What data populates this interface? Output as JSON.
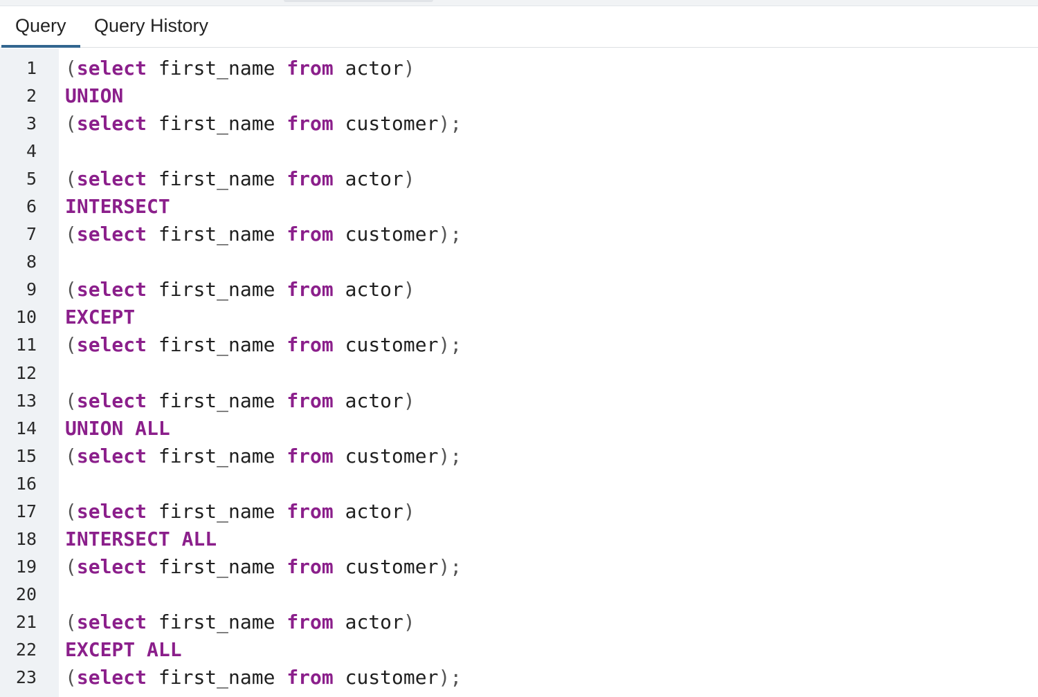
{
  "tabs": [
    {
      "label": "Query",
      "active": true
    },
    {
      "label": "Query History",
      "active": false
    }
  ],
  "colors": {
    "keyword": "#8b1f8b",
    "tab_indicator": "#326690",
    "gutter": "#eff2f5"
  },
  "editor": {
    "lines": [
      [
        {
          "t": "(",
          "c": "punc"
        },
        {
          "t": "select",
          "c": "kw"
        },
        {
          "t": " first_name ",
          "c": "id"
        },
        {
          "t": "from",
          "c": "kw"
        },
        {
          "t": " actor",
          "c": "id"
        },
        {
          "t": ")",
          "c": "punc"
        }
      ],
      [
        {
          "t": "UNION",
          "c": "kw"
        }
      ],
      [
        {
          "t": "(",
          "c": "punc"
        },
        {
          "t": "select",
          "c": "kw"
        },
        {
          "t": " first_name ",
          "c": "id"
        },
        {
          "t": "from",
          "c": "kw"
        },
        {
          "t": " customer",
          "c": "id"
        },
        {
          "t": ");",
          "c": "punc"
        }
      ],
      [],
      [
        {
          "t": "(",
          "c": "punc"
        },
        {
          "t": "select",
          "c": "kw"
        },
        {
          "t": " first_name ",
          "c": "id"
        },
        {
          "t": "from",
          "c": "kw"
        },
        {
          "t": " actor",
          "c": "id"
        },
        {
          "t": ")",
          "c": "punc"
        }
      ],
      [
        {
          "t": "INTERSECT",
          "c": "kw"
        }
      ],
      [
        {
          "t": "(",
          "c": "punc"
        },
        {
          "t": "select",
          "c": "kw"
        },
        {
          "t": " first_name ",
          "c": "id"
        },
        {
          "t": "from",
          "c": "kw"
        },
        {
          "t": " customer",
          "c": "id"
        },
        {
          "t": ");",
          "c": "punc"
        }
      ],
      [],
      [
        {
          "t": "(",
          "c": "punc"
        },
        {
          "t": "select",
          "c": "kw"
        },
        {
          "t": " first_name ",
          "c": "id"
        },
        {
          "t": "from",
          "c": "kw"
        },
        {
          "t": " actor",
          "c": "id"
        },
        {
          "t": ")",
          "c": "punc"
        }
      ],
      [
        {
          "t": "EXCEPT",
          "c": "kw"
        }
      ],
      [
        {
          "t": "(",
          "c": "punc"
        },
        {
          "t": "select",
          "c": "kw"
        },
        {
          "t": " first_name ",
          "c": "id"
        },
        {
          "t": "from",
          "c": "kw"
        },
        {
          "t": " customer",
          "c": "id"
        },
        {
          "t": ");",
          "c": "punc"
        }
      ],
      [],
      [
        {
          "t": "(",
          "c": "punc"
        },
        {
          "t": "select",
          "c": "kw"
        },
        {
          "t": " first_name ",
          "c": "id"
        },
        {
          "t": "from",
          "c": "kw"
        },
        {
          "t": " actor",
          "c": "id"
        },
        {
          "t": ")",
          "c": "punc"
        }
      ],
      [
        {
          "t": "UNION ALL",
          "c": "kw"
        }
      ],
      [
        {
          "t": "(",
          "c": "punc"
        },
        {
          "t": "select",
          "c": "kw"
        },
        {
          "t": " first_name ",
          "c": "id"
        },
        {
          "t": "from",
          "c": "kw"
        },
        {
          "t": " customer",
          "c": "id"
        },
        {
          "t": ");",
          "c": "punc"
        }
      ],
      [],
      [
        {
          "t": "(",
          "c": "punc"
        },
        {
          "t": "select",
          "c": "kw"
        },
        {
          "t": " first_name ",
          "c": "id"
        },
        {
          "t": "from",
          "c": "kw"
        },
        {
          "t": " actor",
          "c": "id"
        },
        {
          "t": ")",
          "c": "punc"
        }
      ],
      [
        {
          "t": "INTERSECT ALL",
          "c": "kw"
        }
      ],
      [
        {
          "t": "(",
          "c": "punc"
        },
        {
          "t": "select",
          "c": "kw"
        },
        {
          "t": " first_name ",
          "c": "id"
        },
        {
          "t": "from",
          "c": "kw"
        },
        {
          "t": " customer",
          "c": "id"
        },
        {
          "t": ");",
          "c": "punc"
        }
      ],
      [],
      [
        {
          "t": "(",
          "c": "punc"
        },
        {
          "t": "select",
          "c": "kw"
        },
        {
          "t": " first_name ",
          "c": "id"
        },
        {
          "t": "from",
          "c": "kw"
        },
        {
          "t": " actor",
          "c": "id"
        },
        {
          "t": ")",
          "c": "punc"
        }
      ],
      [
        {
          "t": "EXCEPT ALL",
          "c": "kw"
        }
      ],
      [
        {
          "t": "(",
          "c": "punc"
        },
        {
          "t": "select",
          "c": "kw"
        },
        {
          "t": " first_name ",
          "c": "id"
        },
        {
          "t": "from",
          "c": "kw"
        },
        {
          "t": " customer",
          "c": "id"
        },
        {
          "t": ");",
          "c": "punc"
        }
      ]
    ]
  }
}
